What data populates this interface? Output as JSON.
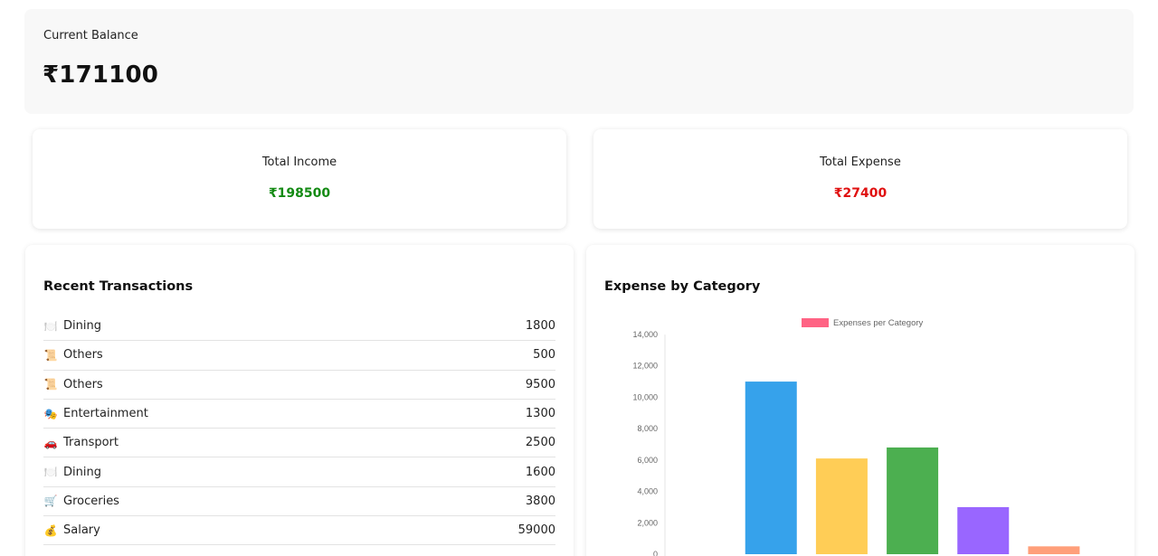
{
  "balance": {
    "label": "Current Balance",
    "value": "₹171100"
  },
  "income": {
    "label": "Total Income",
    "value": "₹198500",
    "color": "#138a13"
  },
  "expense": {
    "label": "Total Expense",
    "value": "₹27400",
    "color": "#e01010"
  },
  "transactions": {
    "title": "Recent Transactions",
    "items": [
      {
        "icon": "🍽️",
        "icon_name": "dining-icon",
        "category": "Dining",
        "amount": "1800"
      },
      {
        "icon": "📜",
        "icon_name": "scroll-icon",
        "category": "Others",
        "amount": "500"
      },
      {
        "icon": "📜",
        "icon_name": "scroll-icon",
        "category": "Others",
        "amount": "9500"
      },
      {
        "icon": "🎭",
        "icon_name": "theater-masks-icon",
        "category": "Entertainment",
        "amount": "1300"
      },
      {
        "icon": "🚗",
        "icon_name": "car-icon",
        "category": "Transport",
        "amount": "2500"
      },
      {
        "icon": "🍽️",
        "icon_name": "dining-icon",
        "category": "Dining",
        "amount": "1600"
      },
      {
        "icon": "🛒",
        "icon_name": "shopping-cart-icon",
        "category": "Groceries",
        "amount": "3800"
      },
      {
        "icon": "💰",
        "icon_name": "money-bag-icon",
        "category": "Salary",
        "amount": "59000"
      }
    ]
  },
  "chart_panel": {
    "title": "Expense by Category"
  },
  "chart_data": {
    "type": "bar",
    "title": "",
    "legend": {
      "label": "Expenses per Category",
      "color": "#ff6384",
      "position": "top"
    },
    "ylim": [
      0,
      14000
    ],
    "yticks": [
      "0",
      "2,000",
      "4,000",
      "6,000",
      "8,000",
      "10,000",
      "12,000",
      "14,000"
    ],
    "grid": false,
    "series": [
      {
        "name": "Expenses per Category",
        "values": [
          0,
          11000,
          6100,
          6800,
          3000,
          500
        ],
        "colors": [
          "#ff6384",
          "#36a2eb",
          "#ffcd56",
          "#4caf50",
          "#9966ff",
          "#ff9f7a"
        ]
      }
    ]
  }
}
